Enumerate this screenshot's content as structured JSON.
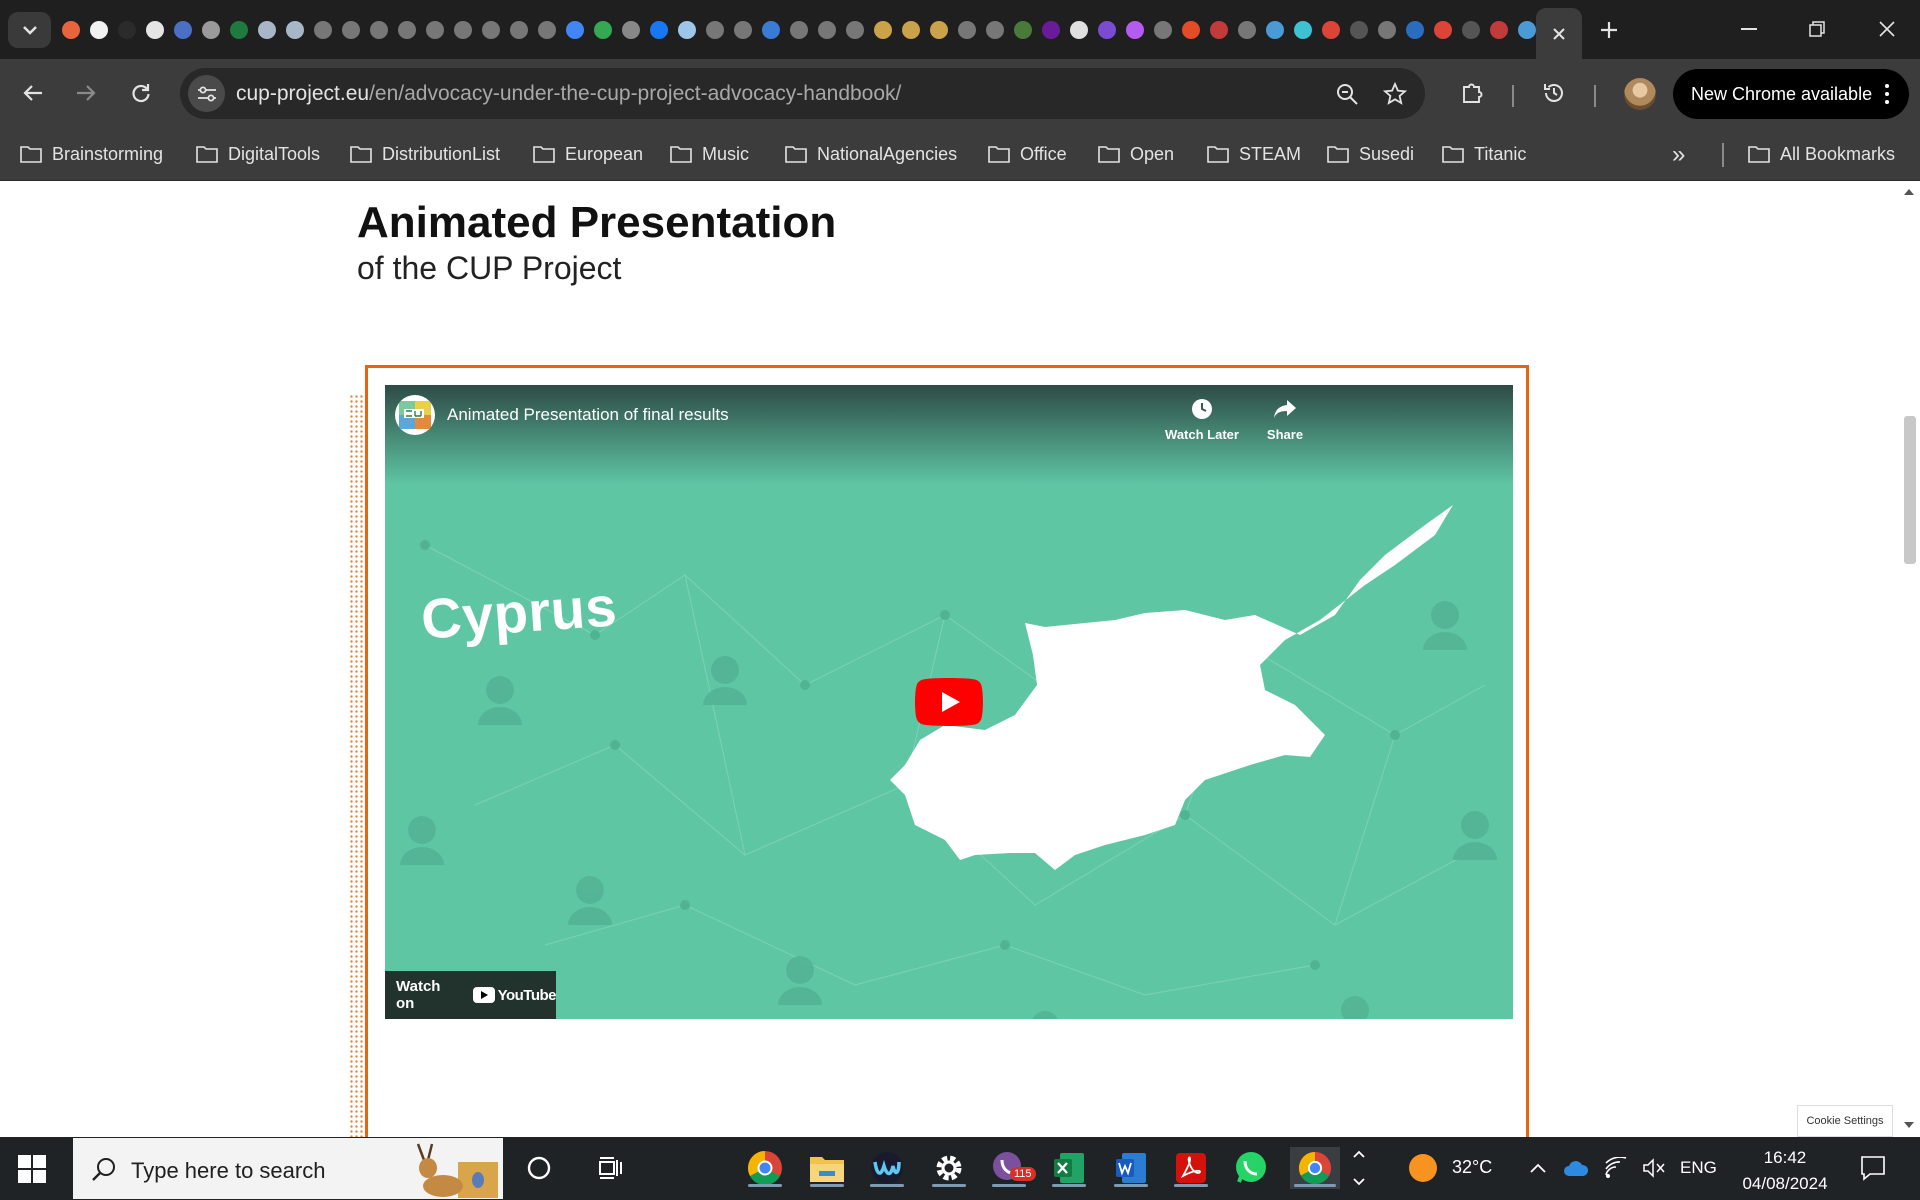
{
  "browser": {
    "url_domain": "cup-project.eu",
    "url_path": "/en/advocacy-under-the-cup-project-advocacy-handbook/",
    "update_button_label": "New Chrome available",
    "bookmarks": [
      {
        "label": "Brainstorming"
      },
      {
        "label": "DigitalTools"
      },
      {
        "label": "DistributionList"
      },
      {
        "label": "European"
      },
      {
        "label": "Music"
      },
      {
        "label": "NationalAgencies"
      },
      {
        "label": "Office"
      },
      {
        "label": "Open"
      },
      {
        "label": "STEAM"
      },
      {
        "label": "Susedi"
      },
      {
        "label": "Titanic"
      }
    ],
    "all_bookmarks_label": "All Bookmarks",
    "more_bookmarks_label": "»"
  },
  "page": {
    "heading": "Animated Presentation",
    "subheading": "of the CUP Project",
    "cookie_label": "Cookie Settings"
  },
  "video": {
    "title": "Animated Presentation of final results",
    "watch_later_label": "Watch Later",
    "share_label": "Share",
    "watch_on_label": "Watch on",
    "youtube_label": "YouTube",
    "overlay_word": "Cyprus",
    "background_color": "#5fc6a4",
    "frame_color": "#e8640f"
  },
  "taskbar": {
    "search_placeholder": "Type here to search",
    "temperature": "32°C",
    "language": "ENG",
    "time": "16:42",
    "date": "04/08/2024",
    "viber_badge": "115"
  }
}
